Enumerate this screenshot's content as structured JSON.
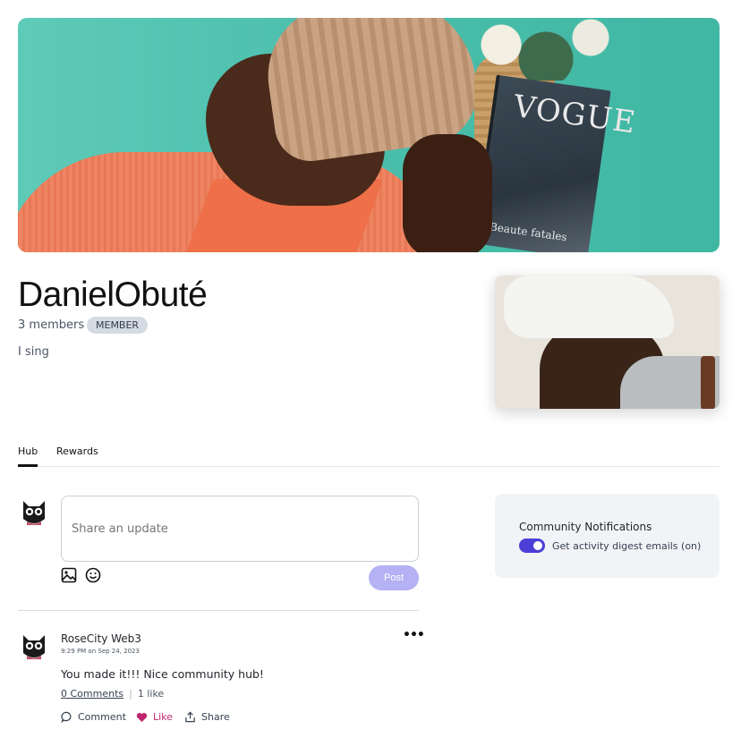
{
  "banner": {
    "alt": "cover-photo",
    "magazine_title": "VOGUE",
    "magazine_subtitle": "Beaute fatales"
  },
  "community": {
    "name": "DanielObuté",
    "members": "3 members",
    "role_badge": "MEMBER",
    "description": "I sing"
  },
  "tabs": [
    {
      "label": "Hub",
      "active": true
    },
    {
      "label": "Rewards",
      "active": false
    }
  ],
  "composer": {
    "placeholder": "Share an update",
    "post_label": "Post"
  },
  "notifications": {
    "title": "Community Notifications",
    "toggle_label": "Get activity digest emails (on)",
    "toggle_on": true,
    "accent": "#4b3fd8"
  },
  "post": {
    "author": "RoseCity Web3",
    "timestamp": "9:29 PM on Sep 24, 2023",
    "text": "You made it!!! Nice community hub!",
    "comments_label": "0 Comments",
    "likes_label": "1 like",
    "actions": {
      "comment": "Comment",
      "like": "Like",
      "share": "Share"
    },
    "like_color": "#c0266e"
  }
}
